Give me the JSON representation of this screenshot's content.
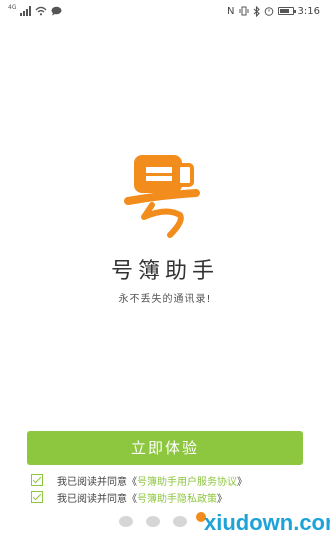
{
  "status_bar": {
    "network_label": "4G",
    "nfc_label": "N",
    "time": "3:16"
  },
  "app": {
    "name": "号簿助手",
    "slogan": "永不丢失的通讯录!"
  },
  "cta": {
    "label": "立即体验"
  },
  "agreements": [
    {
      "prefix": "我已阅读并同意《",
      "link": "号簿助手用户服务协议",
      "suffix": "》",
      "checked": true
    },
    {
      "prefix": "我已阅读并同意《",
      "link": "号簿助手隐私政策",
      "suffix": "》",
      "checked": true
    }
  ],
  "pager": {
    "count": 4,
    "active_index": 3
  },
  "watermark": {
    "text": "xiudown.com"
  },
  "colors": {
    "accent": "#8dc63f",
    "logo": "#f28c1c",
    "watermark": "#1ea3d8"
  }
}
